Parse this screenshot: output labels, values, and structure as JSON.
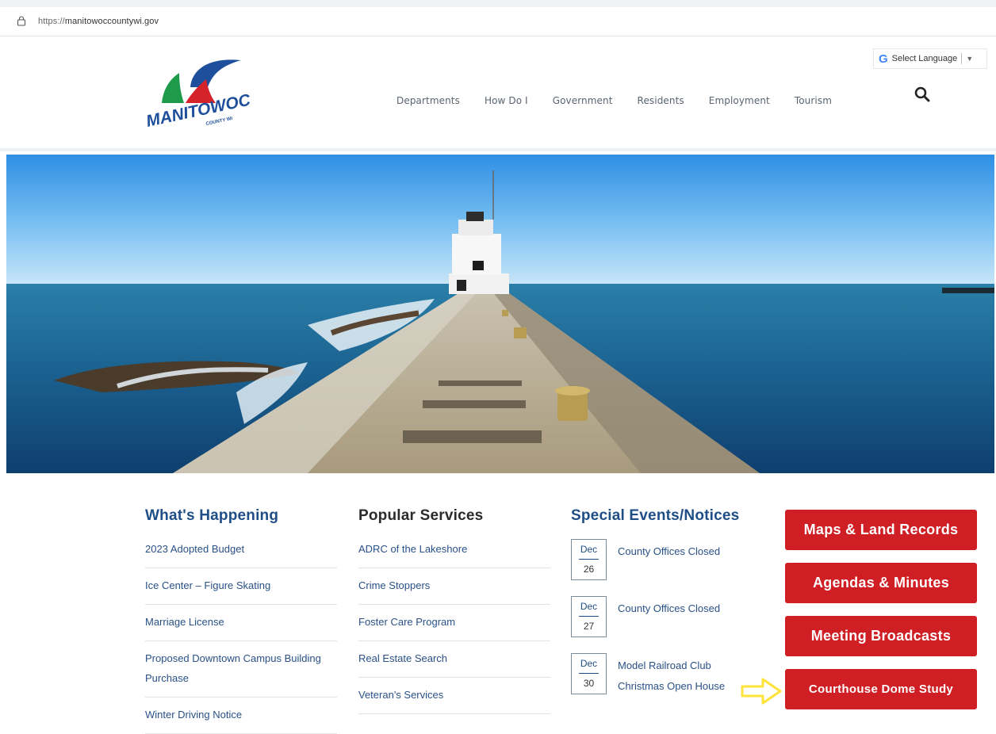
{
  "browser": {
    "url_scheme": "https://",
    "url_host": "manitowoccountywi.gov"
  },
  "header": {
    "logo_text": "MANITOWOC",
    "logo_subtext": "COUNTY WI",
    "nav": [
      "Departments",
      "How Do I",
      "Government",
      "Residents",
      "Employment",
      "Tourism"
    ],
    "language_label": "Select Language",
    "language_google": "G",
    "language_arrow": "▼"
  },
  "what_happening": {
    "title": "What's Happening",
    "items": [
      "2023 Adopted Budget",
      "Ice Center – Figure Skating",
      "Marriage License",
      "Proposed Downtown Campus Building Purchase",
      "Winter Driving Notice"
    ]
  },
  "popular_services": {
    "title": "Popular Services",
    "items": [
      "ADRC of the Lakeshore",
      "Crime Stoppers",
      "Foster Care Program",
      "Real Estate Search",
      "Veteran's Services"
    ]
  },
  "special_events": {
    "title": "Special Events/Notices",
    "items": [
      {
        "month": "Dec",
        "day": "26",
        "title": "County Offices Closed"
      },
      {
        "month": "Dec",
        "day": "27",
        "title": "County Offices Closed"
      },
      {
        "month": "Dec",
        "day": "30",
        "title": "Model Railroad Club Christmas Open House"
      }
    ]
  },
  "quick_links": [
    "Maps & Land Records",
    "Agendas & Minutes",
    "Meeting Broadcasts",
    "Courthouse Dome Study"
  ],
  "colors": {
    "brand_blue": "#1f4e86",
    "button_red": "#cf1f25",
    "arrow_yellow": "#ffe23a"
  }
}
